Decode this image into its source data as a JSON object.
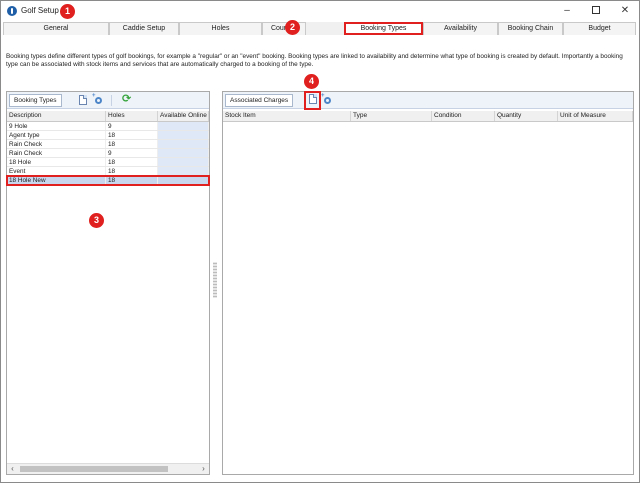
{
  "window": {
    "title": "Golf Setup",
    "minimize": "–",
    "close": "✕"
  },
  "tabs": [
    {
      "label": "General",
      "active": false
    },
    {
      "label": "Caddie Setup",
      "active": false
    },
    {
      "label": "Holes",
      "active": false
    },
    {
      "label": "Courses",
      "active": false
    },
    {
      "label": "Booking Types",
      "active": true
    },
    {
      "label": "Availability",
      "active": false
    },
    {
      "label": "Booking Chain",
      "active": false
    },
    {
      "label": "Budget",
      "active": false
    }
  ],
  "description": "Booking types define different types of golf bookings, for example a \"regular\" or an \"event\" booking. Booking types are linked to availability and determine what type of booking is created by default. Importantly a booking type can be associated with stock items and services that are automatically charged to a booking of the type.",
  "badges": [
    "1",
    "2",
    "3",
    "4"
  ],
  "booking_types": {
    "toolbar_title": "Booking Types",
    "columns": [
      "Description",
      "Holes",
      "Available Online"
    ],
    "rows": [
      {
        "description": "9 Hole",
        "holes": "9",
        "available_online": ""
      },
      {
        "description": "Agent type",
        "holes": "18",
        "available_online": ""
      },
      {
        "description": "Rain Check",
        "holes": "18",
        "available_online": ""
      },
      {
        "description": "Rain Check",
        "holes": "9",
        "available_online": ""
      },
      {
        "description": "18 Hole",
        "holes": "18",
        "available_online": ""
      },
      {
        "description": "Event",
        "holes": "18",
        "available_online": ""
      },
      {
        "description": "18 Hole New",
        "holes": "18",
        "available_online": "",
        "selected": true
      }
    ],
    "scroll_left": "‹",
    "scroll_right": "›"
  },
  "associated_charges": {
    "toolbar_title": "Associated Charges",
    "columns": [
      "Stock Item",
      "Type",
      "Condition",
      "Quantity",
      "Unit of Measure"
    ]
  },
  "colors": {
    "accent_red": "#e0201e",
    "selection": "#c8d7ee",
    "toolbar_bg": "#eef3fa"
  }
}
